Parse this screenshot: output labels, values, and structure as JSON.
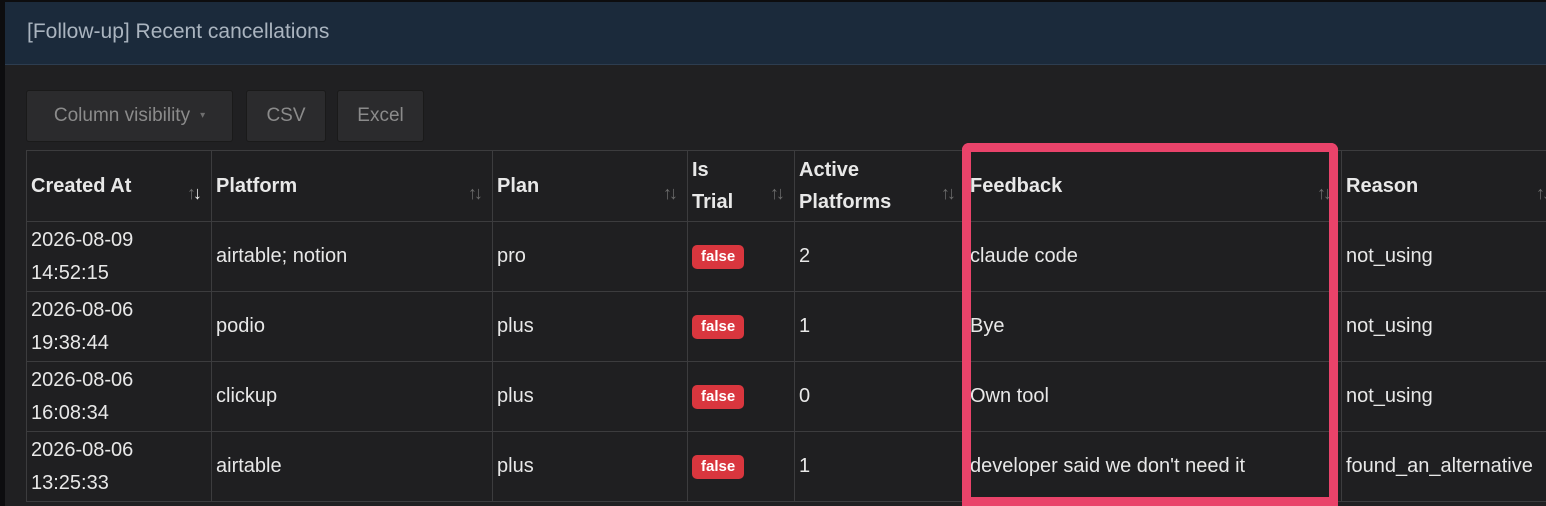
{
  "panel": {
    "title": "[Follow-up] Recent cancellations"
  },
  "toolbar": {
    "column_visibility_label": "Column visibility",
    "caret": "▾",
    "csv_label": "CSV",
    "excel_label": "Excel"
  },
  "table": {
    "headers": {
      "created_at": "Created At",
      "platform": "Platform",
      "plan": "Plan",
      "is_trial": "Is Trial",
      "active_platforms": "Active Platforms",
      "feedback": "Feedback",
      "reason": "Reason"
    },
    "sort": {
      "neutral": "↑↓",
      "up": "↑",
      "down": "↓"
    },
    "rows": [
      {
        "created_at": "2026-08-09 14:52:15",
        "platform": "airtable; notion",
        "plan": "pro",
        "is_trial": "false",
        "active_platforms": "2",
        "feedback": "claude code",
        "reason": "not_using"
      },
      {
        "created_at": "2026-08-06 19:38:44",
        "platform": "podio",
        "plan": "plus",
        "is_trial": "false",
        "active_platforms": "1",
        "feedback": "Bye",
        "reason": "not_using"
      },
      {
        "created_at": "2026-08-06 16:08:34",
        "platform": "clickup",
        "plan": "plus",
        "is_trial": "false",
        "active_platforms": "0",
        "feedback": "Own tool",
        "reason": "not_using"
      },
      {
        "created_at": "2026-08-06 13:25:33",
        "platform": "airtable",
        "plan": "plus",
        "is_trial": "false",
        "active_platforms": "1",
        "feedback": "developer said we don't need it",
        "reason": "found_an_alternative"
      }
    ]
  },
  "colors": {
    "highlight": "#e9436a",
    "badge_false": "#d9363e",
    "header_bar": "#1b2a3b"
  }
}
